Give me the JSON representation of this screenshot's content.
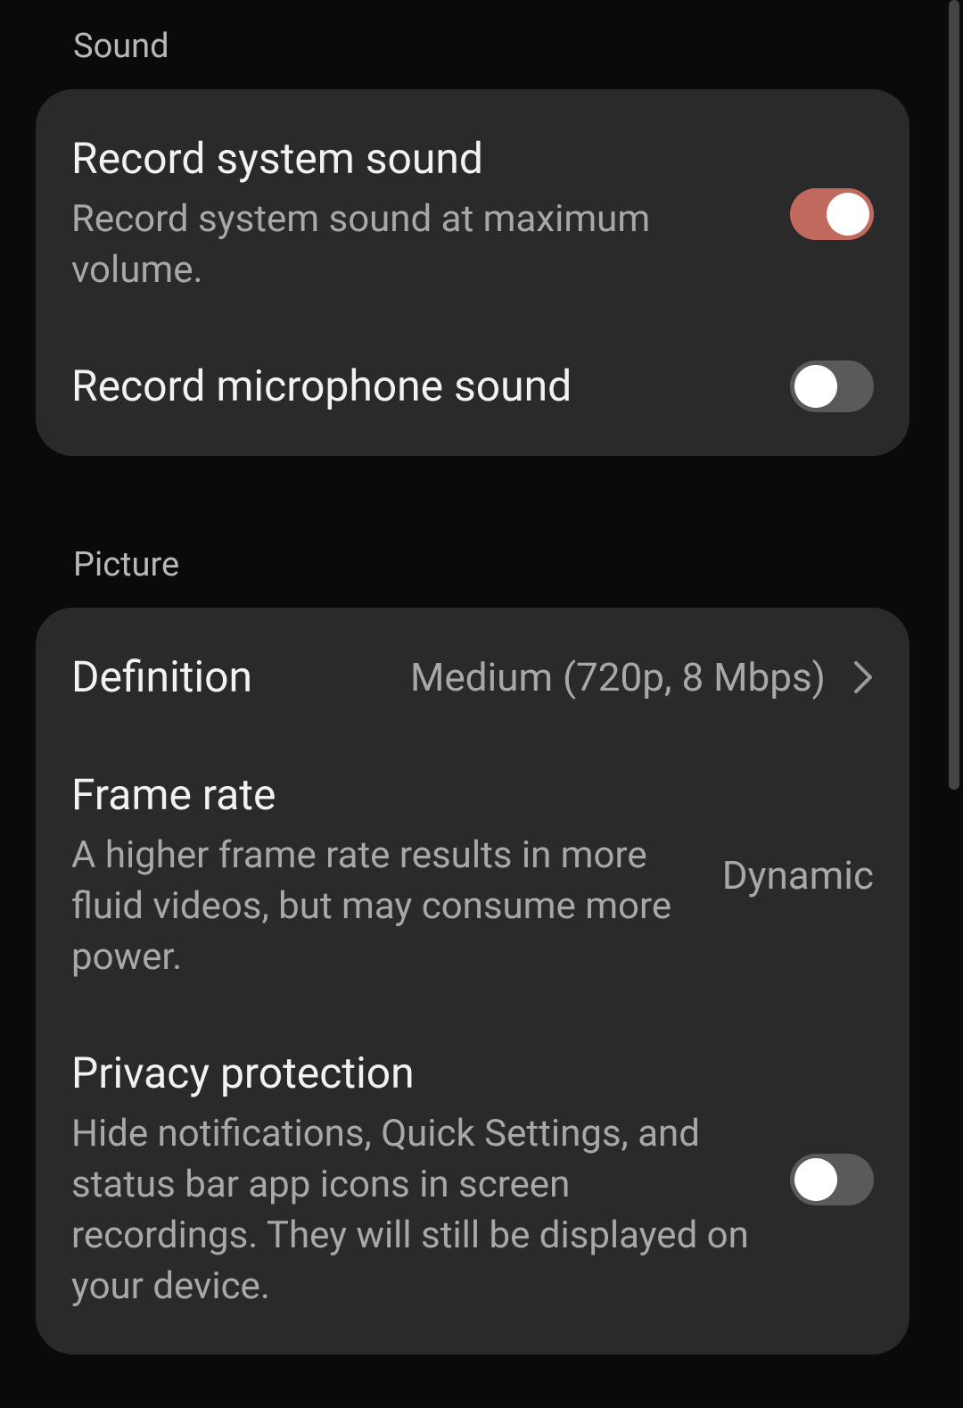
{
  "sections": {
    "sound": {
      "header": "Sound",
      "items": [
        {
          "title": "Record system sound",
          "subtitle": "Record system sound at maximum volume.",
          "toggle": true
        },
        {
          "title": "Record microphone sound",
          "toggle": false
        }
      ]
    },
    "picture": {
      "header": "Picture",
      "items": [
        {
          "title": "Definition",
          "value": "Medium (720p, 8 Mbps)"
        },
        {
          "title": "Frame rate",
          "subtitle": "A higher frame rate results in more fluid videos, but may consume more power.",
          "value": "Dynamic"
        },
        {
          "title": "Privacy protection",
          "subtitle": "Hide notifications, Quick Settings, and status bar app icons in screen recordings. They will still be displayed on your device.",
          "toggle": false
        }
      ]
    }
  },
  "colors": {
    "accent": "#c1695c",
    "background": "#0a0a0a",
    "card": "#2a2a2a"
  }
}
